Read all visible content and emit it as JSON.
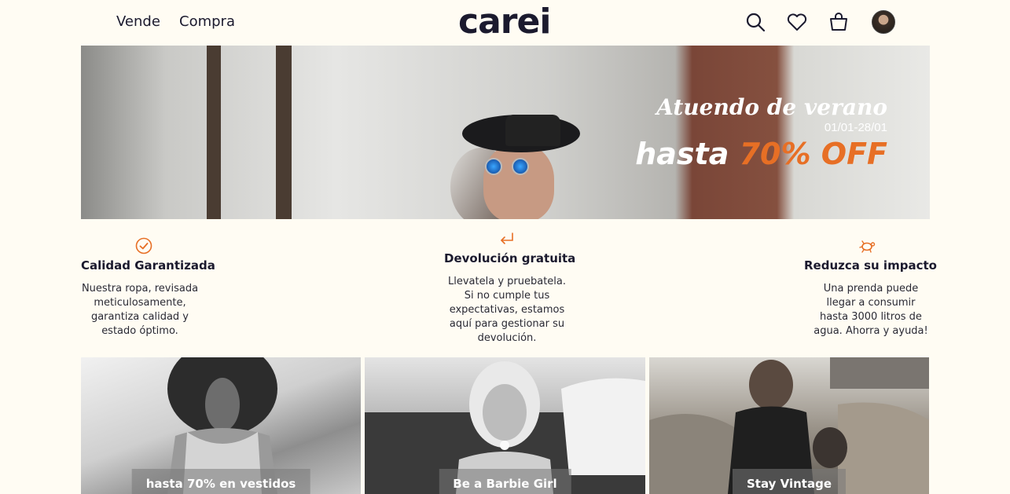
{
  "header": {
    "nav": [
      "Vende",
      "Compra"
    ],
    "logo": "carei",
    "icons": [
      "search-icon",
      "heart-icon",
      "bag-icon",
      "avatar"
    ]
  },
  "hero": {
    "title": "Atuendo de verano",
    "dates": "01/01-28/01",
    "offer_prefix": "hasta",
    "offer_value": "70% OFF"
  },
  "features": [
    {
      "icon": "check-circle-icon",
      "title": "Calidad Garantizada",
      "desc": "Nuestra ropa, revisada meticulosamente, garantiza calidad y estado óptimo."
    },
    {
      "icon": "return-arrow-icon",
      "title": "Devolución gratuita",
      "desc": "Llevatela y pruebatela. Si no cumple tus expectativas, estamos aquí para gestionar su devolución."
    },
    {
      "icon": "turtle-icon",
      "title": "Reduzca su impacto",
      "desc": "Una prenda puede llegar a consumir hasta 3000 litros de agua. Ahorra y ayuda!"
    }
  ],
  "cards": [
    {
      "label": "hasta 70% en vestidos"
    },
    {
      "label": "Be a Barbie Girl"
    },
    {
      "label": "Stay Vintage"
    }
  ],
  "colors": {
    "accent": "#e76f25",
    "text": "#1b1a2e",
    "background": "#fffcf3"
  }
}
